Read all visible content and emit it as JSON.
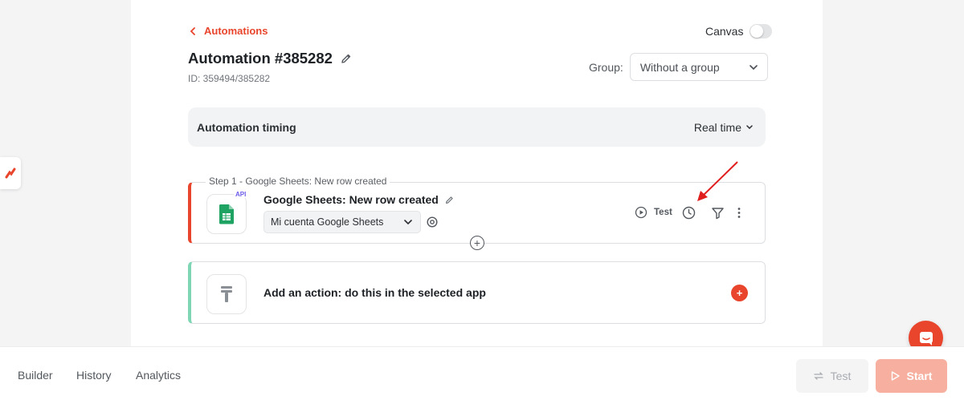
{
  "header": {
    "back_label": "Automations",
    "canvas_label": "Canvas",
    "canvas_on": false,
    "title": "Automation #385282",
    "id_text": "ID: 359494/385282",
    "group_label": "Group:",
    "group_value": "Without a group"
  },
  "timing": {
    "label": "Automation timing",
    "value": "Real time"
  },
  "step": {
    "caption": "Step 1 - Google Sheets: New row created",
    "badge": "API",
    "title": "Google Sheets: New row created",
    "account": "Mi cuenta Google Sheets",
    "test_label": "Test",
    "accent_color": "#e8452c"
  },
  "action": {
    "text": "Add an action: do this in the selected app",
    "add_symbol": "+",
    "accent_color": "#7fd6b4"
  },
  "bottom_nav": {
    "items": [
      "Builder",
      "History",
      "Analytics"
    ],
    "test_label": "Test",
    "start_label": "Start"
  },
  "icons": [
    "chevron-left-icon",
    "edit-pencil-icon",
    "chevron-down-icon",
    "google-sheets-icon",
    "gear-icon",
    "play-circle-icon",
    "clock-icon",
    "filter-icon",
    "more-vertical-icon",
    "plus-circle-icon",
    "text-tool-icon",
    "chat-icon",
    "swap-icon",
    "play-icon",
    "brand-logo-icon",
    "annotation-arrow"
  ],
  "colors": {
    "brand": "#e8452c",
    "arrow": "#e01e1e"
  }
}
